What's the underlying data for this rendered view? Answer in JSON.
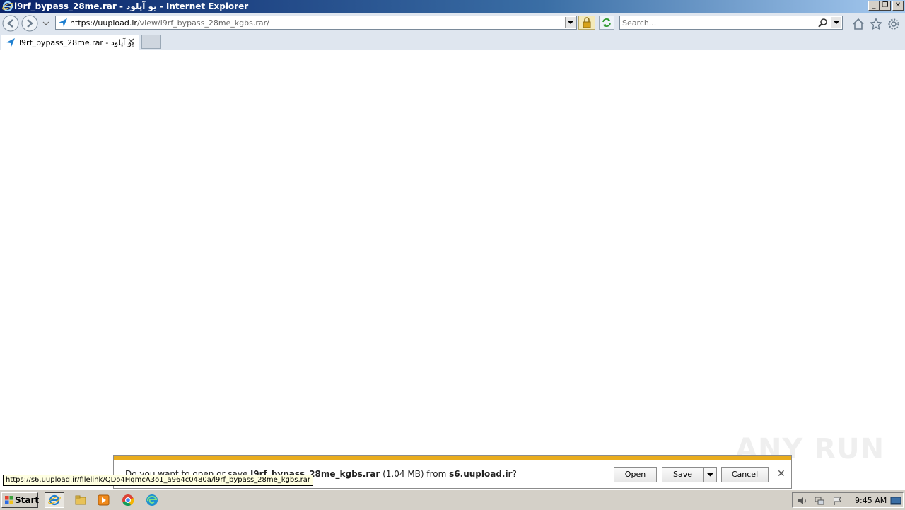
{
  "window": {
    "title": "l9rf_bypass_28me.rar - یو آپلود - Internet Explorer",
    "controls": {
      "minimize": "_",
      "restore": "❐",
      "close": "✕"
    }
  },
  "navbar": {
    "url_host": "https://uupload.ir",
    "url_path": "/view/l9rf_bypass_28me_kgbs.rar/",
    "search_placeholder": "Search..."
  },
  "tabs": [
    {
      "label": "l9rf_bypass_28me.rar - یو آپلود",
      "close": "✕"
    }
  ],
  "download_bar": {
    "prefix": "Do you want to open or save ",
    "filename": "l9rf_bypass_28me_kgbs.rar",
    "size": " (1.04 MB) from ",
    "host": "s6.uupload.ir",
    "suffix": "?",
    "open_label": "Open",
    "save_label": "Save",
    "cancel_label": "Cancel",
    "close_glyph": "✕",
    "accent_color": "#e9ac1d"
  },
  "status_url": "https://s6.uupload.ir/filelink/QDo4HqmcA3o1_a964c0480a/l9rf_bypass_28me_kgbs.rar",
  "watermark": "ANY RUN",
  "taskbar": {
    "start_label": "Start",
    "clock": "9:45 AM",
    "apps": [
      "internet-explorer-icon",
      "file-explorer-icon",
      "media-player-icon",
      "chrome-icon",
      "edge-icon"
    ]
  }
}
